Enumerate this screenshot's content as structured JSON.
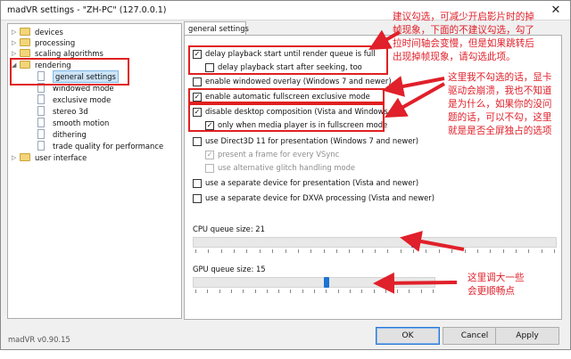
{
  "window": {
    "title": "madVR settings - \"ZH-PC\" (127.0.0.1)",
    "close_glyph": "✕"
  },
  "tree": {
    "items": [
      {
        "label": "devices",
        "expanded": false
      },
      {
        "label": "processing",
        "expanded": false
      },
      {
        "label": "scaling algorithms",
        "expanded": false
      },
      {
        "label": "rendering",
        "expanded": true
      },
      {
        "label": "general settings",
        "selected": true
      },
      {
        "label": "windowed mode"
      },
      {
        "label": "exclusive mode"
      },
      {
        "label": "stereo 3d"
      },
      {
        "label": "smooth motion"
      },
      {
        "label": "dithering"
      },
      {
        "label": "trade quality for performance"
      },
      {
        "label": "user interface",
        "expanded": false
      }
    ]
  },
  "tab": {
    "label": "general settings"
  },
  "options": [
    {
      "label": "delay playback start until render queue is full",
      "checked": true,
      "enabled": true
    },
    {
      "label": "delay playback start after seeking, too",
      "checked": false,
      "enabled": true
    },
    {
      "label": "enable windowed overlay (Windows 7 and newer)",
      "checked": false,
      "enabled": true
    },
    {
      "label": "enable automatic fullscreen exclusive mode",
      "checked": true,
      "enabled": true
    },
    {
      "label": "disable desktop composition (Vista and Windows 7)",
      "checked": true,
      "enabled": true
    },
    {
      "label": "only when media player is in fullscreen mode",
      "checked": true,
      "enabled": true
    },
    {
      "label": "use Direct3D 11 for presentation (Windows 7 and newer)",
      "checked": false,
      "enabled": true
    },
    {
      "label": "present a frame for every VSync",
      "checked": true,
      "enabled": false
    },
    {
      "label": "use alternative glitch handling mode",
      "checked": false,
      "enabled": false
    },
    {
      "label": "use a separate device for presentation (Vista and newer)",
      "checked": false,
      "enabled": true
    },
    {
      "label": "use a separate device for DXVA processing (Vista and newer)",
      "checked": false,
      "enabled": true
    }
  ],
  "sliders": {
    "cpu": {
      "label": "CPU queue size: 21",
      "value": 21,
      "min": 4,
      "max": 32
    },
    "gpu": {
      "label": "GPU queue size: 15",
      "value": 15,
      "min": 4,
      "max": 24
    }
  },
  "annotations": {
    "a1": [
      "建议勾选，可减少开启影片时的掉",
      "帧现象，下面的不建议勾选，勾了",
      "拉时间轴会变慢，但是如果跳转后",
      "出现掉帧现象，请勾选此项。"
    ],
    "a2": [
      "这里我不勾选的话，显卡",
      "驱动会崩溃，我也不知道",
      "是为什么，如果你的没问",
      "题的话，可以不勾，这里",
      "就是是否全屏独占的选项"
    ],
    "a3": [
      "这里调大一些",
      "会更顺畅点"
    ]
  },
  "footer": {
    "version": "madVR v0.90.15"
  },
  "buttons": {
    "ok": "OK",
    "cancel": "Cancel",
    "apply": "Apply"
  },
  "colors": {
    "annotation_red": "#e0202a",
    "slider_thumb": "#1c75d1"
  }
}
